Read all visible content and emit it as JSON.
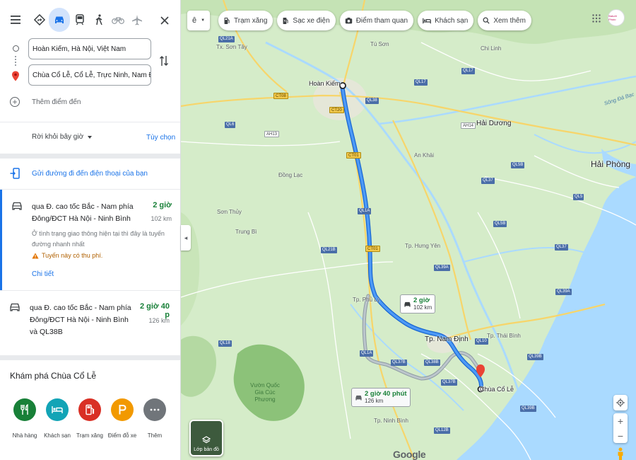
{
  "panel": {
    "origin": "Hoàn Kiếm, Hà Nội, Việt Nam",
    "destination": "Chùa Cổ Lễ, Cổ Lễ, Trực Ninh, Nam Định",
    "add_destination": "Thêm điểm đến",
    "depart_label": "Rời khỏi bây giờ",
    "options_label": "Tùy chọn",
    "send_to_phone": "Gửi đường đi đến điện thoại của bạn",
    "routes": [
      {
        "via": "qua Đ. cao tốc Bắc - Nam phía Đông/ĐCT Hà Nội - Ninh Bình",
        "duration": "2 giờ",
        "distance": "102 km",
        "note": "Ở tình trạng giao thông hiện tại thì đây là tuyến đường nhanh nhất",
        "toll": "Tuyến này có thu phí.",
        "details_link": "Chi tiết"
      },
      {
        "via": "qua Đ. cao tốc Bắc - Nam phía Đông/ĐCT Hà Nội - Ninh Bình và QL38B",
        "duration": "2 giờ 40 p",
        "distance": "126 km"
      }
    ],
    "explore_title": "Khám phá Chùa Cổ Lễ",
    "explore_items": [
      {
        "label": "Nhà hàng",
        "icon": "restaurant-icon",
        "color": "#188038"
      },
      {
        "label": "Khách sạn",
        "icon": "hotel-icon",
        "color": "#12a4b6"
      },
      {
        "label": "Trạm xăng",
        "icon": "gas-station-icon",
        "color": "#d93025"
      },
      {
        "label": "Điểm đỗ xe",
        "icon": "parking-icon",
        "color": "#f29900"
      },
      {
        "label": "Thêm",
        "icon": "more-icon",
        "color": "#70757a"
      }
    ]
  },
  "map": {
    "chip_expand": "ê",
    "chips": [
      {
        "label": "Trạm xăng",
        "icon": "gas-station-icon"
      },
      {
        "label": "Sạc xe điện",
        "icon": "ev-charger-icon"
      },
      {
        "label": "Điểm tham quan",
        "icon": "camera-icon"
      },
      {
        "label": "Khách sạn",
        "icon": "hotel-icon"
      },
      {
        "label": "Xem thêm",
        "icon": "search-icon"
      }
    ],
    "avatar_text": "Nature Photo",
    "route_tip_main": {
      "duration": "2 giờ",
      "distance": "102 km"
    },
    "route_tip_alt": {
      "duration": "2 giờ 40 phút",
      "distance": "126 km"
    },
    "origin_label": "Hoàn Kiếm",
    "destination_label": "Chùa Cổ Lễ",
    "layer_label": "Lớp bản đồ",
    "google": "Google",
    "cities": {
      "hai_phong": "Hải Phòng",
      "hai_duong": "Hải Dương",
      "nam_dinh": "Tp. Nam Định",
      "phu_ly": "Tp. Phủ Lý",
      "hung_yen": "Tp. Hưng Yên",
      "thai_binh": "Tp. Thái Bình",
      "ninh_binh": "Tp. Ninh Bình",
      "son_tay": "Tx. Sơn Tây"
    },
    "towns": [
      "Đồng Lạc",
      "Sơn Thủy",
      "Trung Bì",
      "An Khải",
      "Tú Sơn",
      "Chi Linh"
    ],
    "park": "Vườn Quốc Gia Cúc Phương",
    "river": "Sông Đá Bạc",
    "shields": [
      "QL21A",
      "CT08",
      "AH13",
      "QL6",
      "CT01",
      "QL1A",
      "QL38",
      "QL10",
      "QL37",
      "QL39A",
      "QL39B",
      "QL21B",
      "QL18",
      "AH14",
      "QL5B",
      "QL5",
      "QL17",
      "QL38B",
      "QL37B",
      "QL12B",
      "CT20",
      "QL3",
      "QL2",
      "QL32",
      "QL38",
      "QL18",
      "QL5B",
      "AH1",
      "QL23",
      "QL2C"
    ]
  }
}
